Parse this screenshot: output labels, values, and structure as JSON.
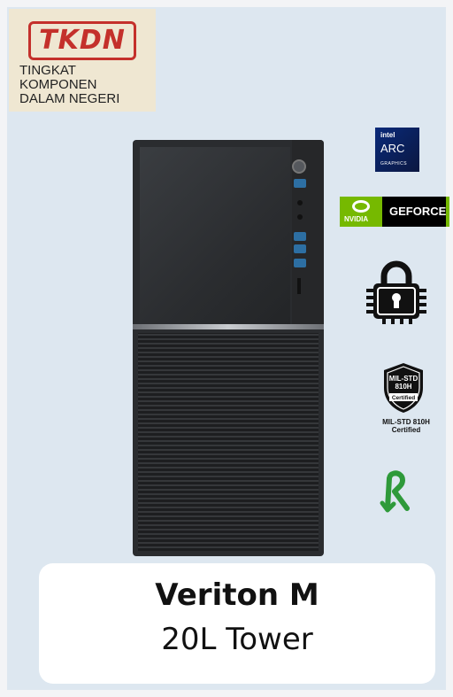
{
  "tkdn": {
    "logo": "TKDN",
    "line1": "TINGKAT",
    "line2": "KOMPONEN",
    "line3": "DALAM NEGERI"
  },
  "badges": {
    "intel": {
      "brand": "intel",
      "name": "ARC",
      "sub": "GRAPHICS"
    },
    "nvidia": {
      "brand": "NVIDIA",
      "name": "GEFORCE"
    },
    "security_icon": "lock-chip-icon",
    "mil_std": {
      "shield_line1": "MIL-STD",
      "shield_line2": "810H",
      "shield_line3": "Certified",
      "caption_line1": "MIL-STD 810H",
      "caption_line2": "Certified"
    },
    "recycle_icon": "recycle-arrow-icon"
  },
  "product": {
    "name": "Veriton M",
    "form_factor": "20L Tower"
  },
  "colors": {
    "background": "#dde7f0",
    "tkdn_red": "#c4302b",
    "nvidia_green": "#76b900",
    "recycle_green": "#2e9a3a"
  }
}
